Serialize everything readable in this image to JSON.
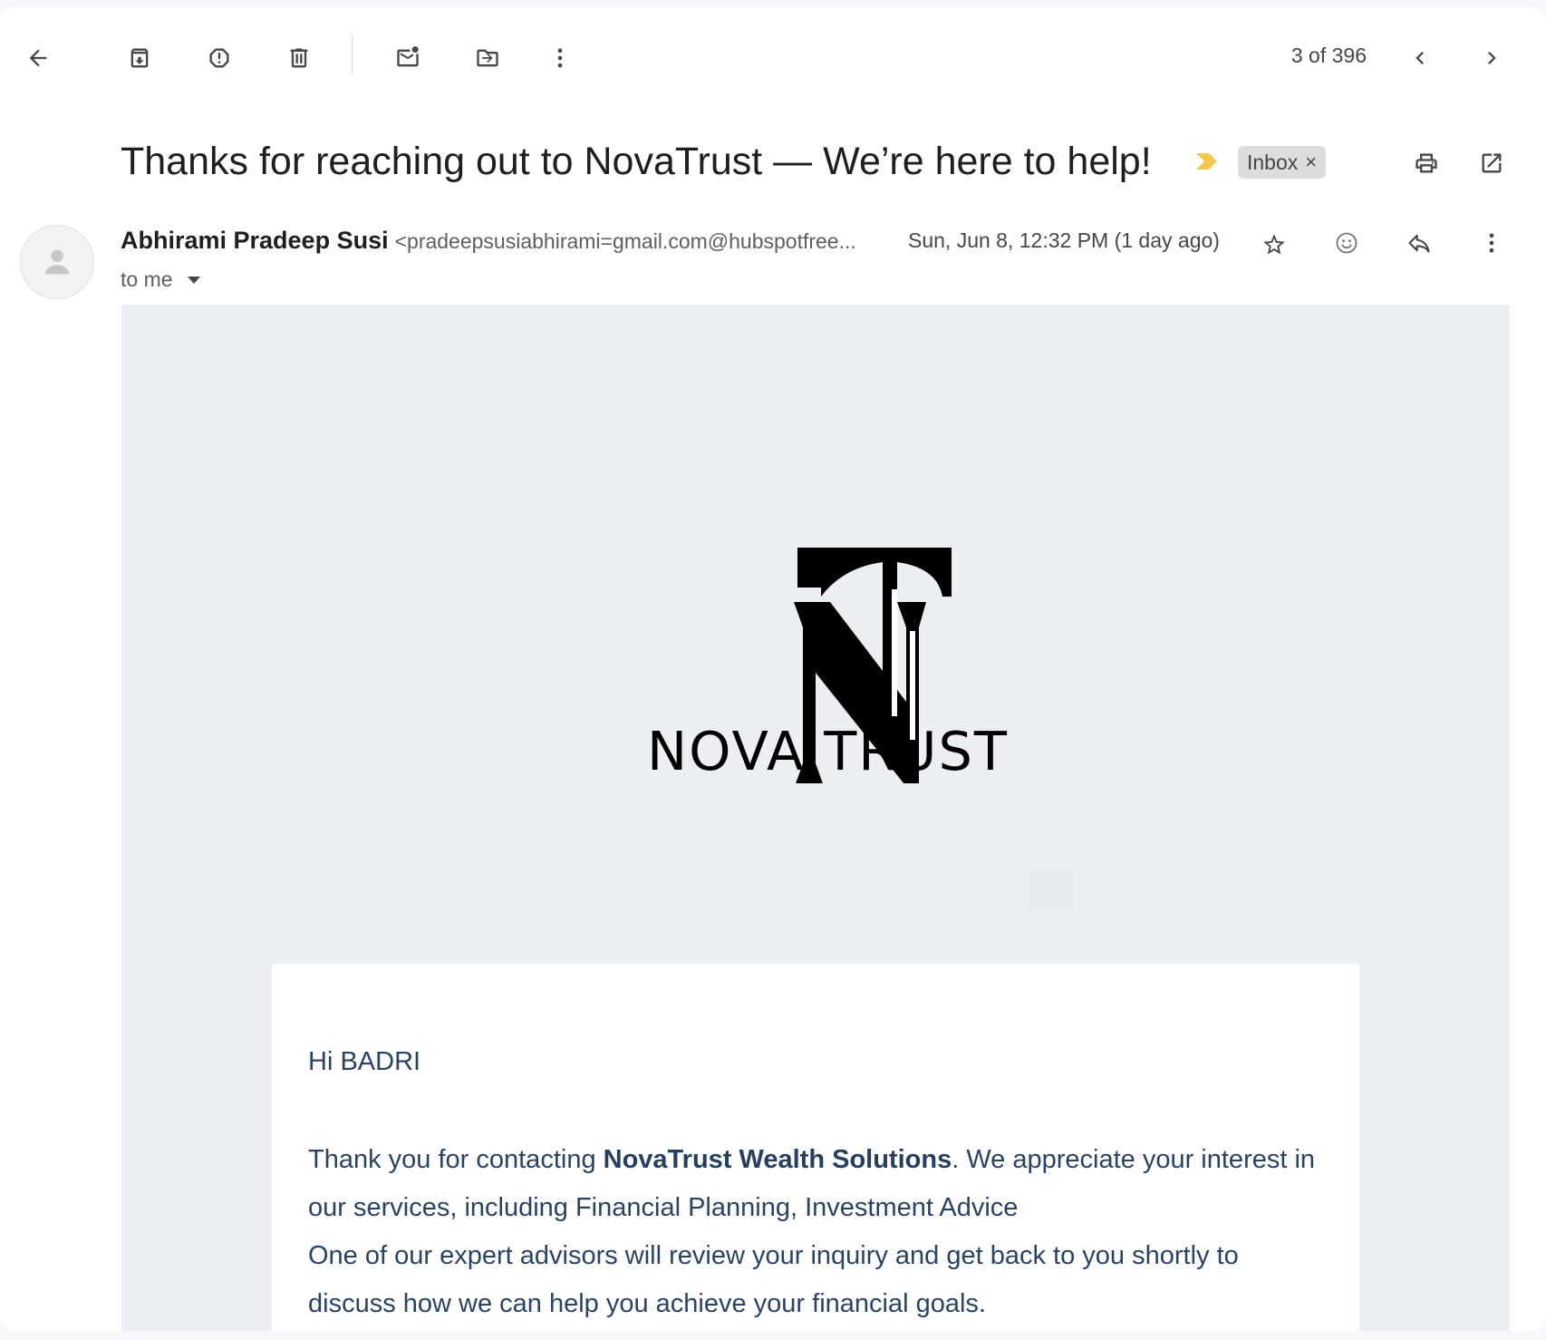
{
  "toolbar": {
    "back_icon": "arrow-left-icon",
    "archive_icon": "archive-icon",
    "report_spam_icon": "report-spam-icon",
    "delete_icon": "trash-icon",
    "mark_unread_icon": "mark-unread-icon",
    "move_to_icon": "move-to-icon",
    "more_icon": "more-vert-icon",
    "counter": "3 of 396",
    "newer_icon": "chevron-left-icon",
    "older_icon": "chevron-right-icon"
  },
  "message": {
    "subject": "Thanks for reaching out to NovaTrust — We’re here to help!",
    "label": "Inbox",
    "label_remove": "×",
    "sender_name": "Abhirami Pradeep Susi",
    "sender_email": "<pradeepsusiabhirami=gmail.com@hubspotfree...",
    "date": "Sun, Jun 8, 12:32 PM (1 day ago)",
    "recipient": "to me"
  },
  "body": {
    "logo_text": "NOVA TRUST",
    "logo_monogram": "NT",
    "greeting": "Hi BADRI",
    "para_start": "Thank you for contacting ",
    "company": "NovaTrust Wealth Solutions",
    "para_rest": ". We appreciate your interest in our services, including Financial Planning, Investment Advice",
    "para2": "One of our expert advisors will review your inquiry and get back to you shortly to discuss how we can help you achieve your financial goals."
  },
  "colors": {
    "importance_marker": "#f2c94c",
    "body_background": "#ebeff3",
    "body_text": "#2b4362"
  }
}
